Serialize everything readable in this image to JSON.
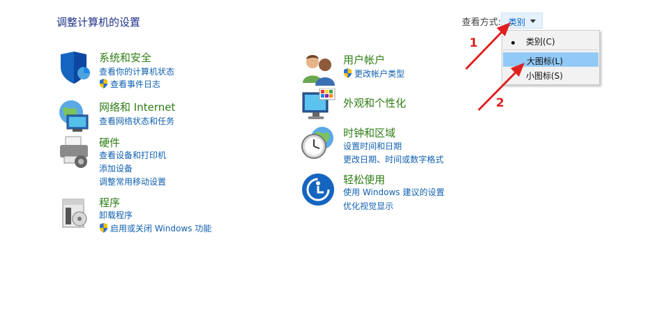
{
  "page_title": "调整计算机的设置",
  "view_by": {
    "label": "查看方式:",
    "selected": "类别",
    "options": [
      "类别(C)",
      "大图标(L)",
      "小图标(S)"
    ],
    "highlighted_option": "大图标(L)"
  },
  "categories_left": [
    {
      "title": "系统和安全",
      "links": [
        "查看你的计算机状态",
        "查看事件日志"
      ],
      "icon": "shield-icon"
    },
    {
      "title": "网络和 Internet",
      "links": [
        "查看网络状态和任务"
      ],
      "icon": "network-globe-icon"
    },
    {
      "title": "硬件",
      "links": [
        "查看设备和打印机",
        "添加设备",
        "调整常用移动设置"
      ],
      "icon": "printer-icon"
    },
    {
      "title": "程序",
      "links": [
        "卸载程序",
        "启用或关闭 Windows 功能"
      ],
      "icon": "programs-box-icon"
    }
  ],
  "categories_right": [
    {
      "title": "用户帐户",
      "links": [
        "更改帐户类型"
      ],
      "icon": "users-icon"
    },
    {
      "title": "外观和个性化",
      "links": [],
      "icon": "monitor-palette-icon"
    },
    {
      "title": "时钟和区域",
      "links": [
        "设置时间和日期",
        "更改日期、时间或数字格式"
      ],
      "icon": "clock-globe-icon"
    },
    {
      "title": "轻松使用",
      "links": [
        "使用 Windows 建议的设置",
        "优化视觉显示"
      ],
      "icon": "ease-of-access-icon"
    }
  ],
  "annotations": [
    "1",
    "2"
  ],
  "colors": {
    "title_green": "#2e7d14",
    "link_blue": "#1060b0",
    "annotation_red": "#e02020",
    "menu_highlight": "#91c9f7"
  }
}
